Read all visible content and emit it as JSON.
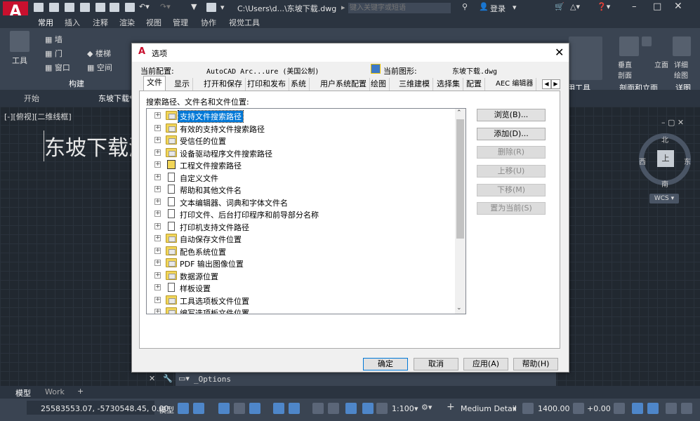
{
  "app": {
    "logo_letter": "A",
    "logo_sub": "A",
    "file_path": "C:\\Users\\d...\\东坡下载.dwg",
    "search_placeholder": "键入关键字或短语",
    "login": "登录",
    "accent": "#c8102e"
  },
  "ribbon": {
    "tabs": [
      "常用",
      "插入",
      "注释",
      "渲染",
      "视图",
      "管理",
      "协作",
      "视觉工具"
    ],
    "panel_label_build": "构建",
    "panel_tool": "工具",
    "panel_groups": [
      "墙",
      "门",
      "窗口",
      "楼梯",
      "空间"
    ],
    "right_panels": {
      "user_tools": "用工具",
      "section_elevation": "剖面和立面",
      "detail": "详图",
      "elevation": "立面",
      "section": "垂直\n剖面",
      "detail_draw": "详细\n绘图"
    }
  },
  "doc_tabs": [
    "开始",
    "东坡下载*"
  ],
  "viewport": {
    "label": "[-][俯视][二维线框]",
    "drawing_text": "东坡下载测",
    "compass": {
      "north": "北",
      "south": "南",
      "east": "东",
      "west": "西",
      "center": "上"
    },
    "wcs": "WCS"
  },
  "dialog": {
    "title": "选项",
    "current_profile_label": "当前配置:",
    "current_profile": "AutoCAD Arc...ure (美国公制)",
    "current_drawing_label": "当前图形:",
    "current_drawing": "东坡下载.dwg",
    "tabs": [
      "文件",
      "显示",
      "打开和保存",
      "打印和发布",
      "系统",
      "用户系统配置",
      "绘图",
      "三维建模",
      "选择集",
      "配置",
      "AEC 编辑器"
    ],
    "tree_label": "搜索路径、文件名和文件位置:",
    "tree_items": [
      {
        "label": "支持文件搜索路径",
        "icon": "folder-icon",
        "selected": true
      },
      {
        "label": "有效的支持文件搜索路径",
        "icon": "folder-icon"
      },
      {
        "label": "受信任的位置",
        "icon": "folder-icon"
      },
      {
        "label": "设备驱动程序文件搜索路径",
        "icon": "folder-icon"
      },
      {
        "label": "工程文件搜索路径",
        "icon": "book-icon"
      },
      {
        "label": "自定义文件",
        "icon": "document-icon"
      },
      {
        "label": "帮助和其他文件名",
        "icon": "document-icon"
      },
      {
        "label": "文本编辑器、词典和字体文件名",
        "icon": "document-icon"
      },
      {
        "label": "打印文件、后台打印程序和前导部分名称",
        "icon": "document-icon"
      },
      {
        "label": "打印机支持文件路径",
        "icon": "document-icon"
      },
      {
        "label": "自动保存文件位置",
        "icon": "folder-icon"
      },
      {
        "label": "配色系统位置",
        "icon": "folder-icon"
      },
      {
        "label": "PDF 输出图像位置",
        "icon": "folder-icon"
      },
      {
        "label": "数据源位置",
        "icon": "folder-icon"
      },
      {
        "label": "样板设置",
        "icon": "document-icon"
      },
      {
        "label": "工具选项板文件位置",
        "icon": "folder-icon"
      },
      {
        "label": "编写选项板文件位置",
        "icon": "folder-icon"
      }
    ],
    "side_buttons": {
      "browse": "浏览(B)...",
      "add": "添加(D)...",
      "remove": "删除(R)",
      "move_up": "上移(U)",
      "move_down": "下移(M)",
      "set_current": "置为当前(S)"
    },
    "bottom_buttons": {
      "ok": "确定",
      "cancel": "取消",
      "apply": "应用(A)",
      "help": "帮助(H)"
    }
  },
  "command_line": {
    "text": "_Options"
  },
  "layout_tabs": [
    "模型",
    "Work",
    "+"
  ],
  "status": {
    "coords": "25583553.07, -5730548.45, 0.00",
    "space": "模型",
    "scale": "1:100",
    "detail": "Medium Detail",
    "elevation": "1400.00",
    "offset": "+0.00"
  }
}
